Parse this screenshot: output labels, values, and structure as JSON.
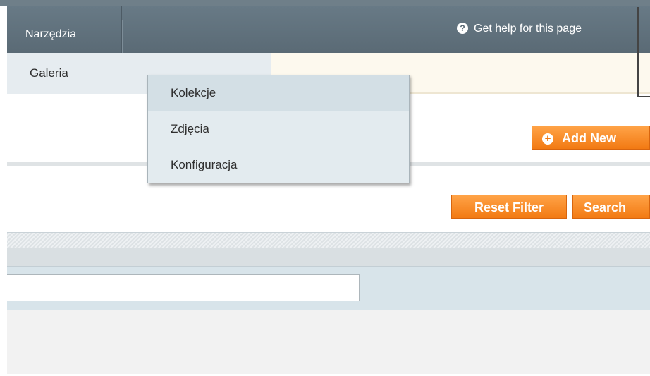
{
  "nav": {
    "active_item": "Narzędzia",
    "help_text": "Get help for this page"
  },
  "subnav": {
    "item": "Galeria"
  },
  "dropdown": {
    "items": [
      "Kolekcje",
      "Zdjęcia",
      "Konfiguracja"
    ]
  },
  "buttons": {
    "add_new": "Add New",
    "reset_filter": "Reset Filter",
    "search": "Search"
  },
  "icons": {
    "help": "question-circle-icon",
    "add": "plus-circle-icon"
  },
  "colors": {
    "nav_bg": "#5a6a75",
    "button_orange": "#f27a13",
    "subnav_bg": "#e6ecf0"
  }
}
